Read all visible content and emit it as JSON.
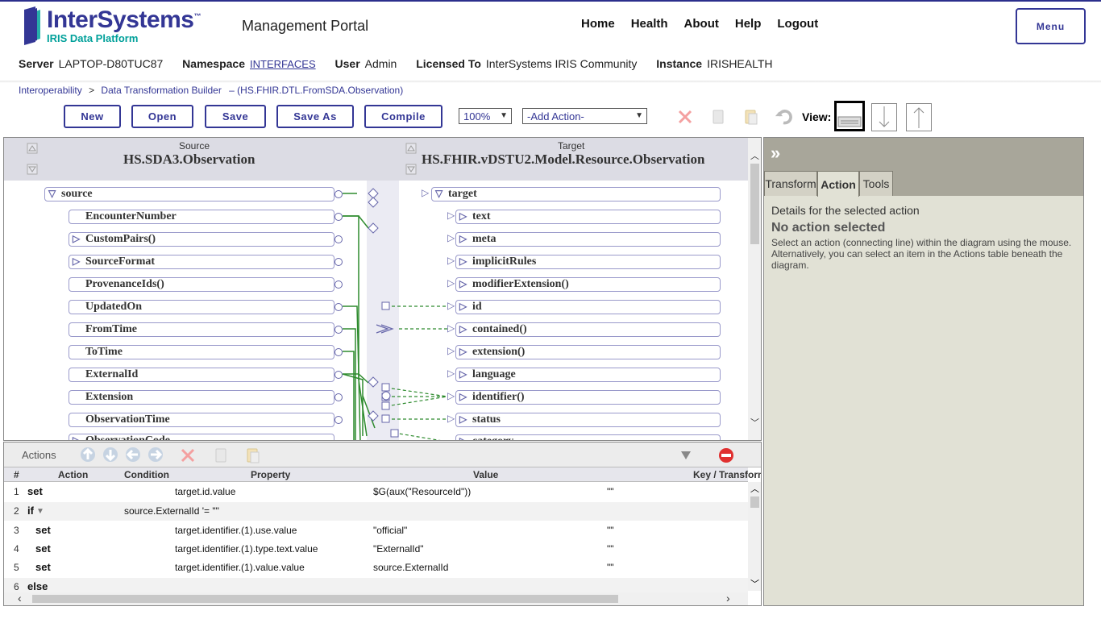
{
  "brand": {
    "name": "InterSystems",
    "tm": "™",
    "sub": "IRIS Data Platform"
  },
  "header": {
    "title": "Management Portal",
    "nav": [
      "Home",
      "Health",
      "About",
      "Help",
      "Logout"
    ],
    "menu_label": "Menu"
  },
  "info": {
    "server_label": "Server",
    "server": "LAPTOP-D80TUC87",
    "namespace_label": "Namespace",
    "namespace": "INTERFACES",
    "user_label": "User",
    "user": "Admin",
    "licensed_label": "Licensed To",
    "licensed": "InterSystems IRIS Community",
    "instance_label": "Instance",
    "instance": "IRISHEALTH"
  },
  "breadcrumb": {
    "items": [
      "Interoperability",
      "Data Transformation Builder"
    ],
    "separator": ">",
    "current": "– (HS.FHIR.DTL.FromSDA.Observation)"
  },
  "toolbar": {
    "new": "New",
    "open": "Open",
    "save": "Save",
    "save_as": "Save As",
    "compile": "Compile",
    "zoom": "100%",
    "add_action": "-Add Action-",
    "view_label": "View:"
  },
  "diagram": {
    "source_caption": "Source",
    "source_class": "HS.SDA3.Observation",
    "target_caption": "Target",
    "target_class": "HS.FHIR.vDSTU2.Model.Resource.Observation",
    "source_root": "source",
    "source_fields": [
      "EncounterNumber",
      "CustomPairs()",
      "SourceFormat",
      "ProvenanceIds()",
      "UpdatedOn",
      "FromTime",
      "ToTime",
      "ExternalId",
      "Extension",
      "ObservationTime",
      "ObservationCode"
    ],
    "target_root": "target",
    "target_fields": [
      "text",
      "meta",
      "implicitRules",
      "modifierExtension()",
      "id",
      "contained()",
      "extension()",
      "language",
      "identifier()",
      "status",
      "category"
    ]
  },
  "actions": {
    "label": "Actions",
    "columns": [
      "#",
      "Action",
      "Condition",
      "Property",
      "Value",
      "Key / Transform"
    ],
    "rows": [
      {
        "n": "1",
        "action": "set",
        "condition": "",
        "property": "target.id.value",
        "value": "$G(aux(\"ResourceId\"))",
        "key": "\"\""
      },
      {
        "n": "2",
        "action": "if",
        "condition": "source.ExternalId '= \"\"",
        "property": "",
        "value": "",
        "key": ""
      },
      {
        "n": "3",
        "action": "set",
        "condition": "",
        "property": "target.identifier.(1).use.value",
        "value": "\"official\"",
        "key": "\"\""
      },
      {
        "n": "4",
        "action": "set",
        "condition": "",
        "property": "target.identifier.(1).type.text.value",
        "value": "\"ExternalId\"",
        "key": "\"\""
      },
      {
        "n": "5",
        "action": "set",
        "condition": "",
        "property": "target.identifier.(1).value.value",
        "value": "source.ExternalId",
        "key": "\"\""
      },
      {
        "n": "6",
        "action": "else",
        "condition": "",
        "property": "",
        "value": "",
        "key": ""
      }
    ]
  },
  "panel": {
    "tabs": [
      "Transform",
      "Action",
      "Tools"
    ],
    "active_tab": "Action",
    "heading": "Details for the selected action",
    "status": "No action selected",
    "help": "Select an action (connecting line) within the diagram using the mouse. Alternatively, you can select an item in the Actions table beneath the diagram."
  },
  "colors": {
    "brand": "#333695",
    "accent": "#00a09a",
    "link_line": "#2e8b2e"
  }
}
